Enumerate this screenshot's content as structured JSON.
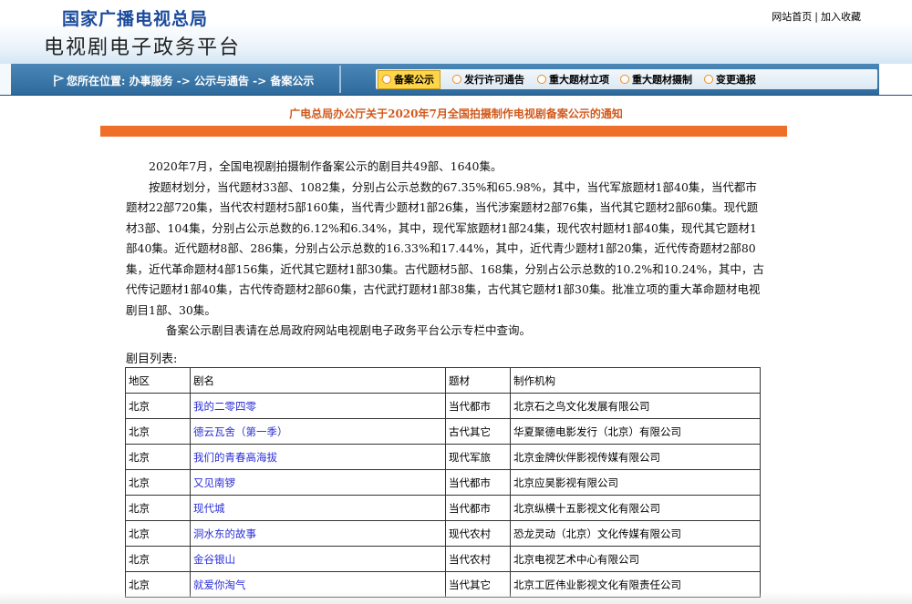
{
  "header": {
    "agency": "国家广播电视总局",
    "platform": "电视剧电子政务平台",
    "links": {
      "home": "网站首页",
      "sep": "|",
      "favorite": "加入收藏"
    }
  },
  "nav": {
    "breadcrumb": "您所在位置: 办事服务 -> 公示与通告 -> 备案公示",
    "tabs": [
      {
        "label": "备案公示",
        "active": true
      },
      {
        "label": "发行许可通告",
        "active": false
      },
      {
        "label": "重大题材立项",
        "active": false
      },
      {
        "label": "重大题材摄制",
        "active": false
      },
      {
        "label": "变更通报",
        "active": false
      }
    ]
  },
  "notice": {
    "title": "广电总局办公厅关于2020年7月全国拍摄制作电视剧备案公示的通知",
    "paragraphs": [
      "2020年7月，全国电视剧拍摄制作备案公示的剧目共49部、1640集。",
      "按题材划分，当代题材33部、1082集，分别占公示总数的67.35%和65.98%，其中，当代军旅题材1部40集，当代都市题材22部720集，当代农村题材5部160集，当代青少题材1部26集，当代涉案题材2部76集，当代其它题材2部60集。现代题材3部、104集，分别占公示总数的6.12%和6.34%，其中，现代军旅题材1部24集，现代农村题材1部40集，现代其它题材1部40集。近代题材8部、286集，分别占公示总数的16.33%和17.44%，其中，近代青少题材1部20集，近代传奇题材2部80集，近代革命题材4部156集，近代其它题材1部30集。古代题材5部、168集，分别占公示总数的10.2%和10.24%，其中，古代传记题材1部40集，古代传奇题材2部60集，古代武打题材1部38集，古代其它题材1部30集。批准立项的重大革命题材电视剧目1部、30集。",
      "备案公示剧目表请在总局政府网站电视剧电子政务平台公示专栏中查询。"
    ]
  },
  "list": {
    "title": "剧目列表:",
    "headers": [
      "地区",
      "剧名",
      "题材",
      "制作机构"
    ],
    "rows": [
      [
        "北京",
        "我的二零四零",
        "当代都市",
        "北京石之鸟文化发展有限公司"
      ],
      [
        "北京",
        "德云瓦舍（第一季）",
        "古代其它",
        "华夏聚德电影发行（北京）有限公司"
      ],
      [
        "北京",
        "我们的青春高海拔",
        "现代军旅",
        "北京金牌伙伴影视传媒有限公司"
      ],
      [
        "北京",
        "又见南锣",
        "当代都市",
        "北京应昊影视有限公司"
      ],
      [
        "北京",
        "现代城",
        "当代都市",
        "北京纵横十五影视文化有限公司"
      ],
      [
        "北京",
        "洞水东的故事",
        "现代农村",
        "恐龙灵动（北京）文化传媒有限公司"
      ],
      [
        "北京",
        "金谷银山",
        "当代农村",
        "北京电视艺术中心有限公司"
      ],
      [
        "北京",
        "就爱你淘气",
        "当代其它",
        "北京工匠伟业影视文化有限责任公司"
      ]
    ]
  }
}
